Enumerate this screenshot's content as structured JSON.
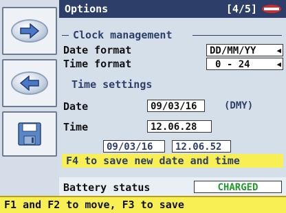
{
  "header": {
    "title": "Options",
    "page": "[4/5]"
  },
  "sidebar": [
    {
      "name": "next-button",
      "icon": "arrow-right-icon"
    },
    {
      "name": "back-button",
      "icon": "arrow-left-icon"
    },
    {
      "name": "save-button",
      "icon": "floppy-disk-icon"
    }
  ],
  "clock": {
    "section_title": "Clock management",
    "date_format_label": "Date format",
    "date_format_value": "DD/MM/YY",
    "time_format_label": "Time format",
    "time_format_value": "0 - 24"
  },
  "time_settings": {
    "section_title": "Time settings",
    "date_label": "Date",
    "date_value": "09/03/16",
    "date_hint": "(DMY)",
    "time_label": "Time",
    "time_value": "12.06.28",
    "current_date": "09/03/16",
    "current_time": "12.06.52",
    "save_hint": "F4 to save new date and time"
  },
  "battery": {
    "label": "Battery status",
    "value": "CHARGED"
  },
  "status_bar": {
    "text": "F1 and F2 to move, F3 to save"
  },
  "colors": {
    "header_bg": "#2d3f69",
    "hint_bg": "#f8ef55",
    "charged_text": "#1f9a2c"
  }
}
